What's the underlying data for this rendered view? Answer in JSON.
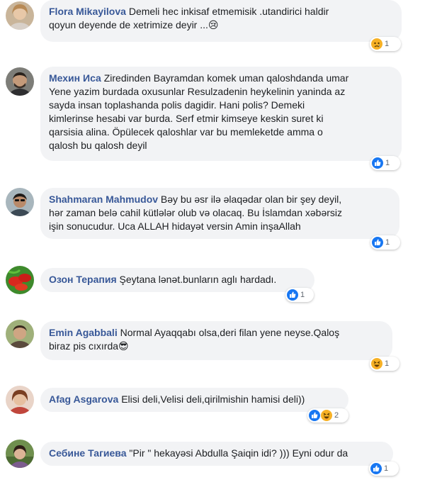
{
  "comments": [
    {
      "author": "Flora Mikayilova",
      "lines": [
        "Demeli hec inkisaf etmemisik .utandirici haldir",
        "qoyun deyende de xetrimize deyir ...😢"
      ],
      "reactions": {
        "icons": [
          "sad-icon"
        ],
        "count": "1"
      }
    },
    {
      "author": "Мехин Иса",
      "lines": [
        "Ziredinden Bayramdan komek uman qaloshdanda umar",
        "Yene yazim burdada oxusunlar Resulzadenin heykelinin yaninda az",
        "sayda insan toplashanda polis dagidir. Hani polis? Demeki",
        "kimlerinse hesabi var burda. Serf etmir kimseye keskin suret ki",
        "qarsisia alina. Öpülecek qaloshlar var bu memleketde amma o",
        "qalosh bu qalosh deyil"
      ],
      "reactions": {
        "icons": [
          "like-icon"
        ],
        "count": "1"
      }
    },
    {
      "author": "Shahmaran Mahmudov",
      "lines": [
        "Bəy bu əsr ilə əlaqədar olan bir şey deyil,",
        "hər zaman belə cahil kütlələr olub və olacaq. Bu İslamdan xəbərsiz",
        "işin sonucudur. Uca ALLAH hidayət versin Amin inşaAllah"
      ],
      "reactions": {
        "icons": [
          "like-icon"
        ],
        "count": "1"
      }
    },
    {
      "author": "Озон Терапия",
      "lines": [
        "Şeytana lənət.bunların aglı hardadı."
      ],
      "reactions": {
        "icons": [
          "like-icon"
        ],
        "count": "1"
      }
    },
    {
      "author": "Emin Agabbali",
      "lines": [
        "Normal Ayaqqabı olsa,deri filan yene neyse.Qaloş",
        "biraz pis cıxırda😎"
      ],
      "reactions": {
        "icons": [
          "haha-icon"
        ],
        "count": "1"
      }
    },
    {
      "author": "Afag Asgarova",
      "lines": [
        "Elisi deli,Velisi deli,qirilmishin hamisi deli))"
      ],
      "reactions": {
        "icons": [
          "like-icon",
          "haha-icon"
        ],
        "count": "2"
      }
    },
    {
      "author": "Себине Тагиева",
      "lines": [
        "\"Pir \" hekayəsi Abdulla Şaiqin idi? ))) Eyni odur da"
      ],
      "reactions": {
        "icons": [
          "like-icon"
        ],
        "count": "1"
      }
    }
  ],
  "colors": {
    "author": "#385898",
    "bubble": "#f2f3f5",
    "like": "#1877f2",
    "emoji": "#f7b125"
  }
}
